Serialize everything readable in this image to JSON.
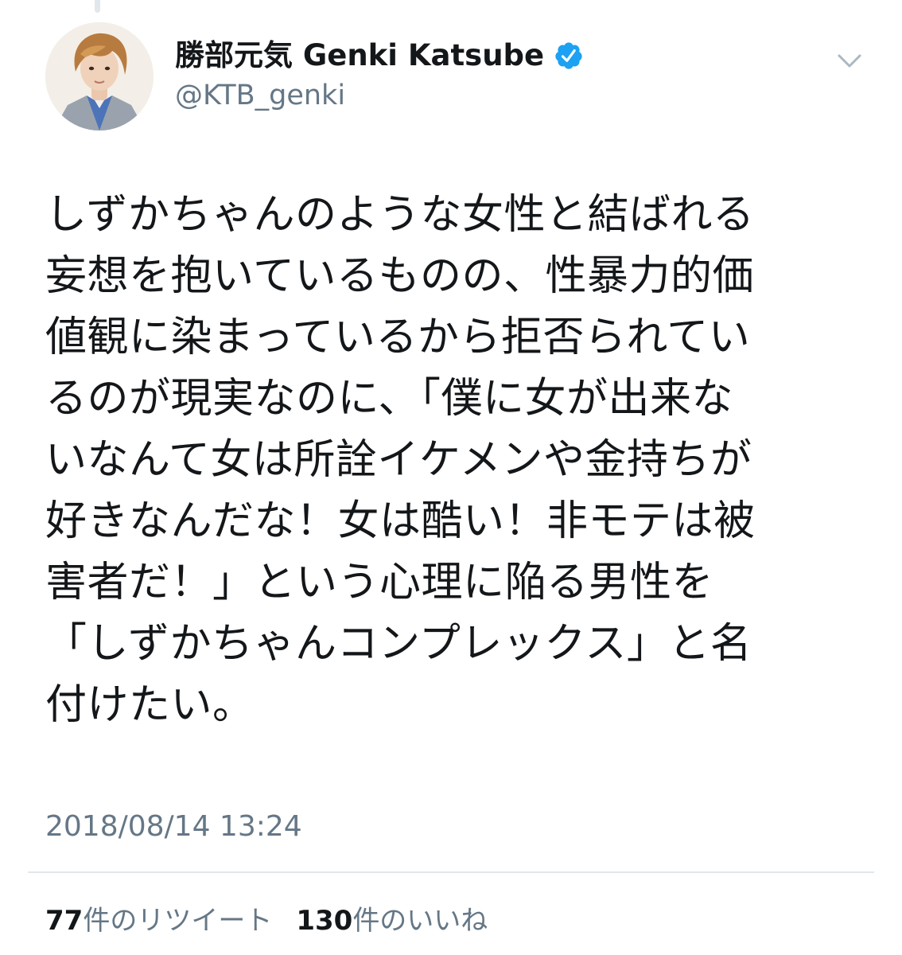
{
  "user": {
    "display_name": "勝部元気 Genki Katsube",
    "handle": "@KTB_genki",
    "verified": true,
    "avatar_icon": "profile-photo-avatar",
    "verified_icon": "verified-badge-icon",
    "verified_color": "#1da1f2"
  },
  "menu": {
    "icon": "chevron-down-icon"
  },
  "tweet": {
    "lines": [
      "しずかちゃんのような女性と結ばれる",
      "妄想を抱いているものの、性暴力的価",
      "値観に染まっているから拒否られてい",
      "るのが現実なのに、「僕に女が出来な",
      "いなんて女は所詮イケメンや金持ちが",
      "好きなんだな！女は酷い！非モテは被",
      "害者だ！」という心理に陥る男性を",
      "「しずかちゃんコンプレックス」と名",
      "付けたい。"
    ],
    "timestamp": "2018/08/14 13:24"
  },
  "stats": {
    "retweets": {
      "count": "77",
      "label": "件のリツイート"
    },
    "likes": {
      "count": "130",
      "label": "件のいいね"
    }
  },
  "colors": {
    "text": "#14171a",
    "secondary": "#657786",
    "divider": "#e1e8ed",
    "accent": "#1da1f2"
  }
}
